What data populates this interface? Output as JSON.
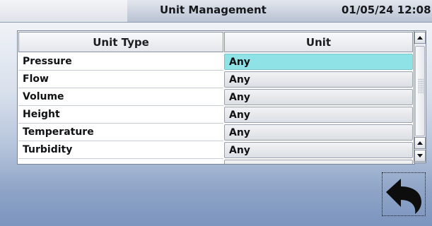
{
  "header": {
    "title": "Unit Management",
    "datetime": "01/05/24 12:08"
  },
  "table": {
    "columns": [
      "Unit Type",
      "Unit"
    ],
    "rows": [
      {
        "type": "Pressure",
        "unit": "Any",
        "selected": true
      },
      {
        "type": "Flow",
        "unit": "Any",
        "selected": false
      },
      {
        "type": "Volume",
        "unit": "Any",
        "selected": false
      },
      {
        "type": "Height",
        "unit": "Any",
        "selected": false
      },
      {
        "type": "Temperature",
        "unit": "Any",
        "selected": false
      },
      {
        "type": "Turbidity",
        "unit": "Any",
        "selected": false
      }
    ]
  },
  "colors": {
    "selected_row": "#8fe3e6",
    "background_bottom": "#7c95bf"
  },
  "icons": {
    "back": "back-arrow-icon",
    "scroll_up": "triangle-up-icon",
    "scroll_down": "triangle-down-icon"
  }
}
